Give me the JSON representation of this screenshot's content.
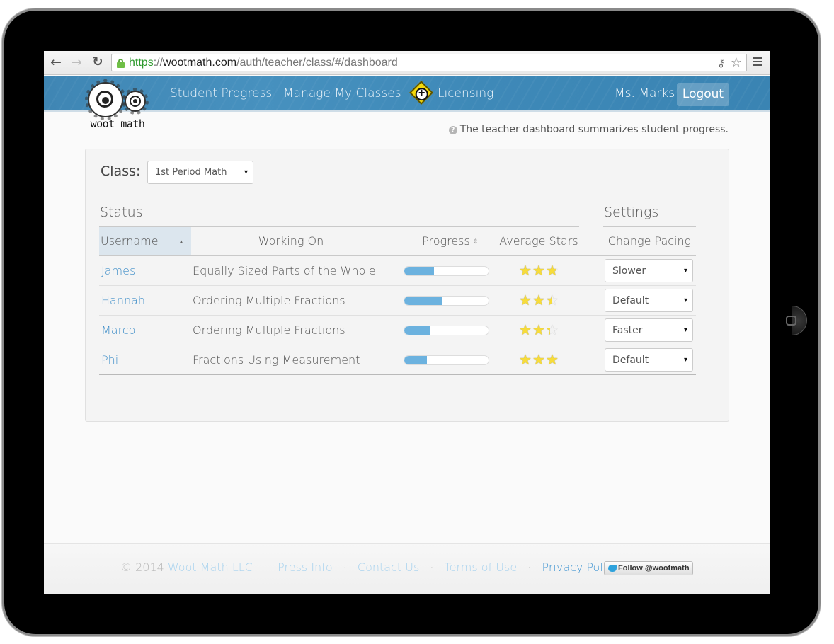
{
  "browser": {
    "url_scheme": "https",
    "url_sep": "://",
    "url_host": "wootmath.com",
    "url_path": "/auth/teacher/class/#/dashboard",
    "icons": {
      "back": "←",
      "forward": "→",
      "reload": "↻",
      "key": "⚷",
      "bookmark": "☆"
    }
  },
  "header": {
    "logo_text": "woot math",
    "nav": [
      {
        "label": "Student Progress"
      },
      {
        "label": "Manage My Classes"
      },
      {
        "label": "Licensing",
        "icon": "licensing-plus-diamond-icon"
      }
    ],
    "user_name": "Ms. Marks",
    "logout_label": "Logout"
  },
  "help": {
    "icon": "?",
    "text": "The teacher dashboard summarizes student progress."
  },
  "panel": {
    "class_label": "Class:",
    "class_selected": "1st Period Math",
    "caret": "▾",
    "status_title": "Status",
    "settings_title": "Settings",
    "columns": {
      "username": "Username",
      "working_on": "Working On",
      "progress": "Progress",
      "average_stars": "Average Stars",
      "change_pacing": "Change Pacing"
    },
    "sort_icons": {
      "asc": "▲",
      "both": "⇕"
    },
    "star_glyph": "★",
    "max_stars": 3,
    "rows": [
      {
        "username": "James",
        "working_on": "Equally Sized Parts of the Whole",
        "progress": 0.35,
        "stars": 2.75,
        "pacing": "Slower"
      },
      {
        "username": "Hannah",
        "working_on": "Ordering Multiple Fractions",
        "progress": 0.45,
        "stars": 2.4,
        "pacing": "Default"
      },
      {
        "username": "Marco",
        "working_on": "Ordering Multiple Fractions",
        "progress": 0.3,
        "stars": 2.3,
        "pacing": "Faster"
      },
      {
        "username": "Phil",
        "working_on": "Fractions Using Measurement",
        "progress": 0.27,
        "stars": 3,
        "pacing": "Default"
      }
    ]
  },
  "footer": {
    "copyright": "© 2014",
    "company": "Woot Math LLC",
    "links": [
      "Press Info",
      "Contact Us",
      "Terms of Use",
      "Privacy Policy"
    ],
    "separator": "·",
    "twitter_label": "Follow @wootmath"
  },
  "colors": {
    "header_blue": "#4190bf",
    "link_blue": "#3f8ec8",
    "progress_fill": "#6cb2df",
    "star_yellow": "#f7dc3a"
  }
}
